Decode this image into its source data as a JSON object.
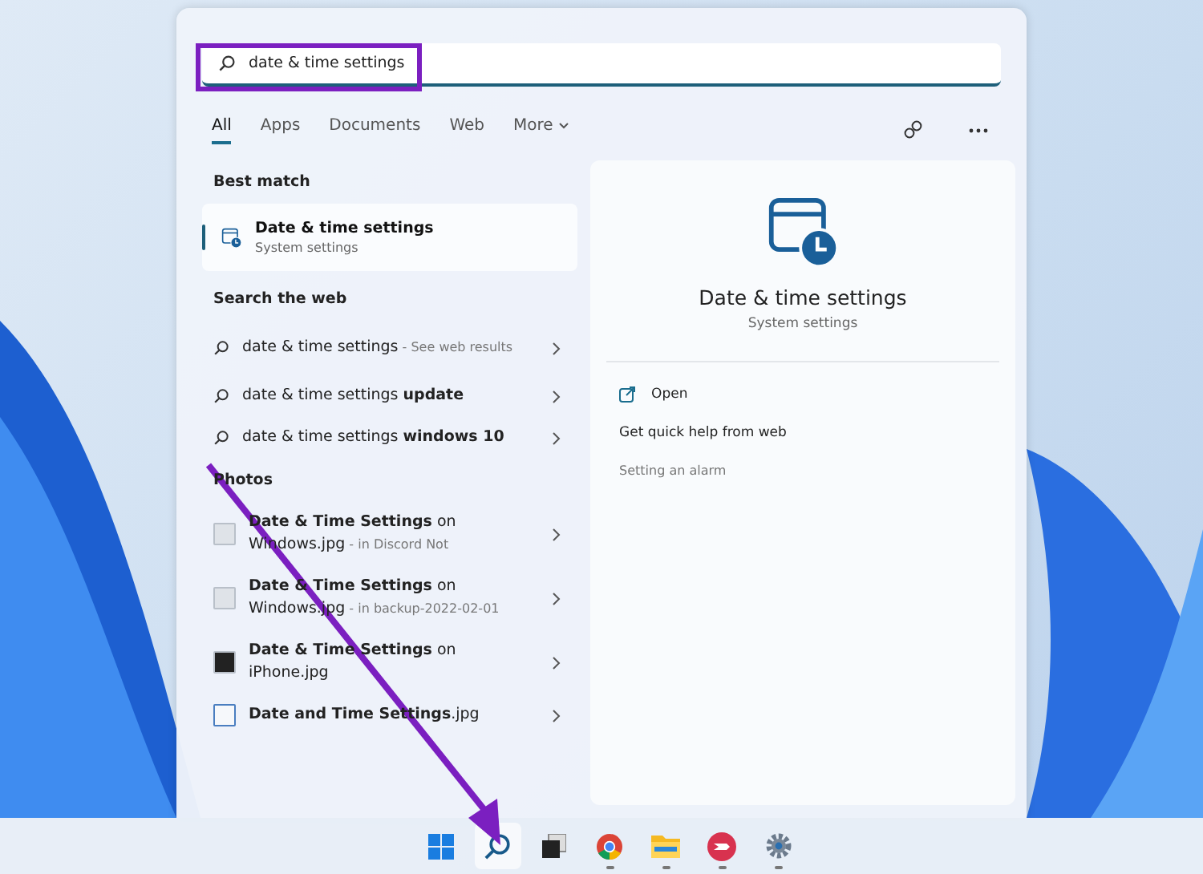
{
  "search": {
    "value": "date & time settings"
  },
  "tabs": [
    {
      "label": "All",
      "selected": true,
      "kind": "plain"
    },
    {
      "label": "Apps",
      "selected": false,
      "kind": "plain"
    },
    {
      "label": "Documents",
      "selected": false,
      "kind": "plain"
    },
    {
      "label": "Web",
      "selected": false,
      "kind": "plain"
    },
    {
      "label": "More",
      "selected": false,
      "kind": "menu"
    }
  ],
  "best_match": {
    "heading": "Best match",
    "title": "Date & time settings",
    "subtitle": "System settings",
    "selected": true
  },
  "web": {
    "heading": "Search the web",
    "items": [
      {
        "title": "date & time settings",
        "detail": "- See web results"
      },
      {
        "title": "date & time settings **update**"
      },
      {
        "title": "date & time settings **windows 10**"
      }
    ]
  },
  "photos": {
    "heading": "Photos",
    "items": [
      {
        "title": "**Date & Time Settings** on Windows.jpg",
        "detail": "- in Discord Not",
        "kind": "blank"
      },
      {
        "title": "**Date & Time Settings** on Windows.jpg",
        "detail": "- in backup-2022-02-01",
        "kind": "blank"
      },
      {
        "title": "**Date & Time Settings** on iPhone.jpg",
        "kind": "dark"
      },
      {
        "title": "**Date and Time Settings**.jpg",
        "kind": "doc"
      }
    ]
  },
  "preview": {
    "title": "Date & time settings",
    "subtitle": "System settings",
    "actions": [
      {
        "label": "Open",
        "kind": "open"
      },
      {
        "label": "Get quick help from web",
        "kind": "heading"
      },
      {
        "label": "Setting an alarm",
        "kind": "link"
      }
    ]
  },
  "taskbar": [
    {
      "kind": "start",
      "selected": false,
      "running": false
    },
    {
      "kind": "search",
      "selected": true,
      "running": false
    },
    {
      "kind": "taskview",
      "selected": false,
      "running": false
    },
    {
      "kind": "browser",
      "selected": false,
      "running": true
    },
    {
      "kind": "folder",
      "selected": false,
      "running": true
    },
    {
      "kind": "app",
      "selected": false,
      "running": true
    },
    {
      "kind": "settings",
      "selected": false,
      "running": true
    }
  ]
}
